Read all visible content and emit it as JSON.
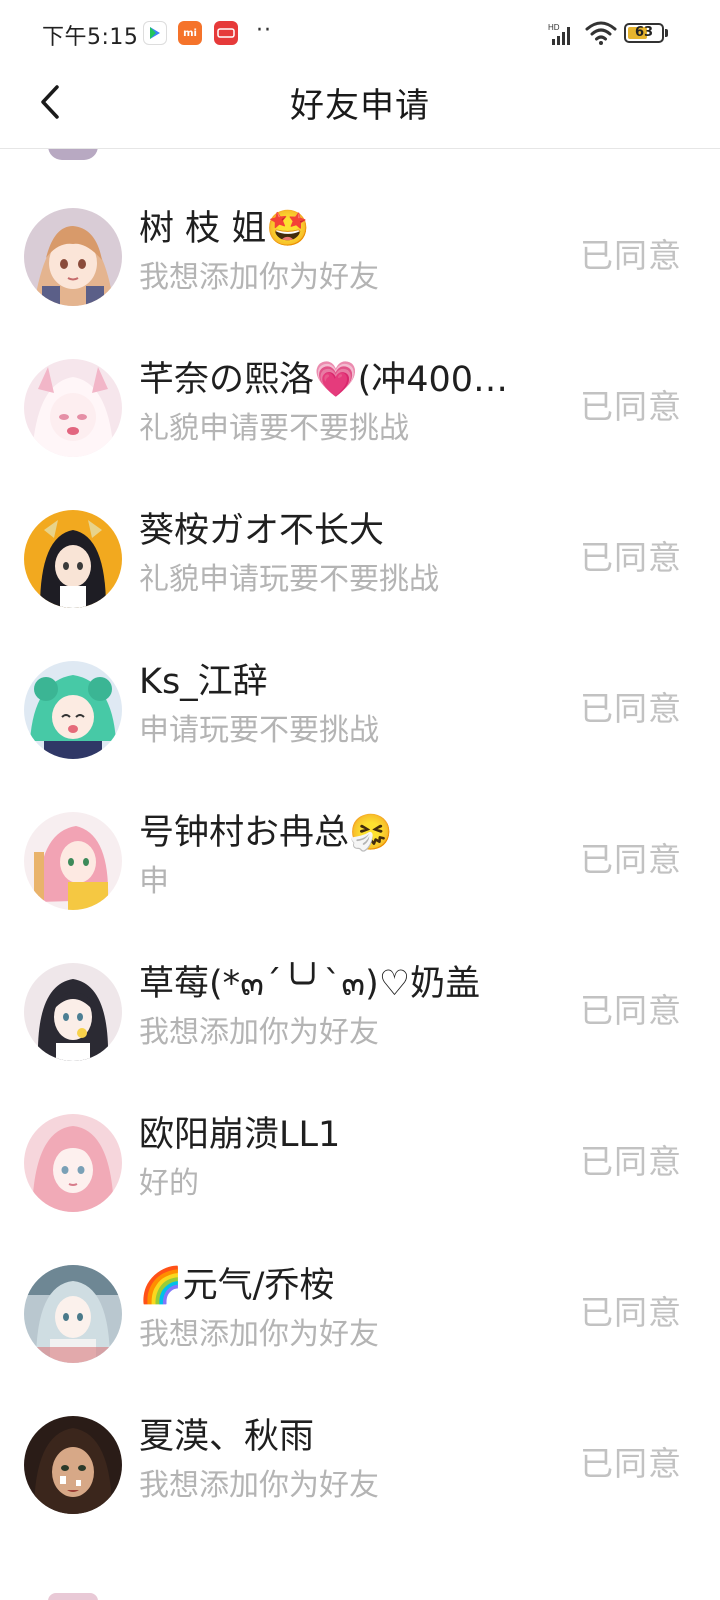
{
  "status_bar": {
    "time": "下午5:15",
    "dots": "··",
    "battery": "63",
    "battery_level_percent": 63,
    "network": "HD",
    "icons": [
      "play-store-icon",
      "mi-icon",
      "news-app-icon",
      "signal-icon",
      "wifi-icon",
      "battery-icon"
    ]
  },
  "header": {
    "title": "好友申请",
    "back_icon": "chevron-left-icon"
  },
  "colors": {
    "name": "#1f1f1f",
    "message": "#b4b4b4",
    "status": "#c2c2c2",
    "divider": "#e6e6e6",
    "background": "#ffffff"
  },
  "requests": [
    {
      "name": "树 枝 姐🤩",
      "message": "我想添加你为好友",
      "status": "已同意",
      "avatar": "avatar-orange-hair-girl"
    },
    {
      "name": "芊奈の熙洛💗(冲400…",
      "message": "礼貌申请要不要挑战",
      "status": "已同意",
      "avatar": "avatar-pink-white-girl"
    },
    {
      "name": "葵桉ガオ不长大",
      "message": "礼貌申请玩要不要挑战",
      "status": "已同意",
      "avatar": "avatar-dark-hair-yellow-bg"
    },
    {
      "name": "Ks_江辞",
      "message": "申请玩要不要挑战",
      "status": "已同意",
      "avatar": "avatar-green-hair-girl"
    },
    {
      "name": "号钟村お冉总🤧",
      "message": "申",
      "status": "已同意",
      "avatar": "avatar-pink-hair-girl"
    },
    {
      "name": "草莓(*๓´╰╯`๓)♡奶盖",
      "message": "我想添加你为好友",
      "status": "已同意",
      "avatar": "avatar-black-hair-girl"
    },
    {
      "name": "欧阳崩溃LL1",
      "message": "好的",
      "status": "已同意",
      "avatar": "avatar-pink-soft-girl"
    },
    {
      "name": "🌈元气/乔桉",
      "message": "我想添加你为好友",
      "status": "已同意",
      "avatar": "avatar-silver-hair-girl"
    },
    {
      "name": "夏漠、秋雨",
      "message": "我想添加你为好友",
      "status": "已同意",
      "avatar": "avatar-dark-portrait"
    }
  ]
}
